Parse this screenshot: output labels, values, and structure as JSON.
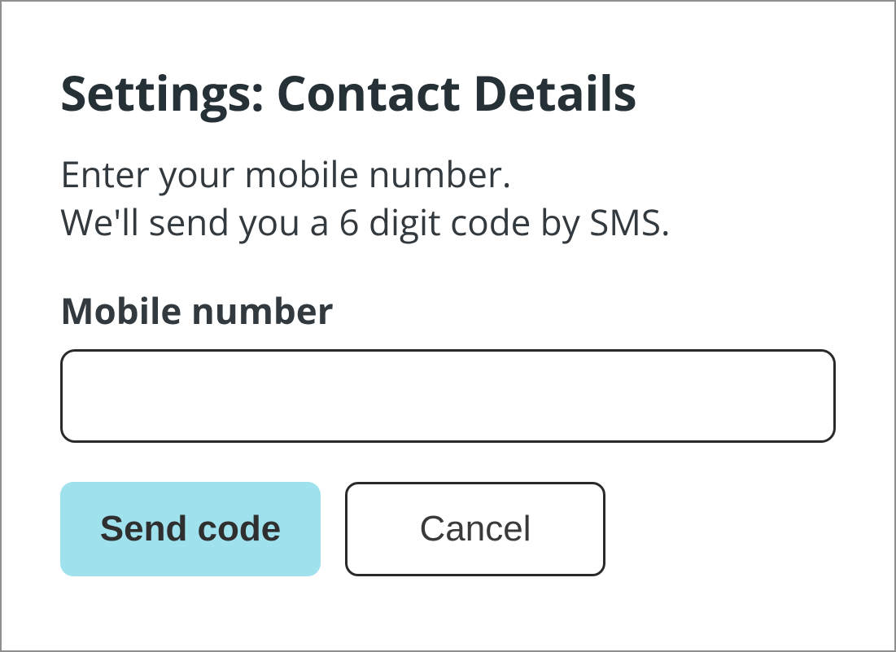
{
  "header": {
    "title": "Settings: Contact Details"
  },
  "instructions": {
    "line1": "Enter your mobile number.",
    "line2": "We'll send you a 6 digit code by SMS."
  },
  "field": {
    "label": "Mobile number",
    "value": ""
  },
  "buttons": {
    "primary": "Send code",
    "secondary": "Cancel"
  }
}
